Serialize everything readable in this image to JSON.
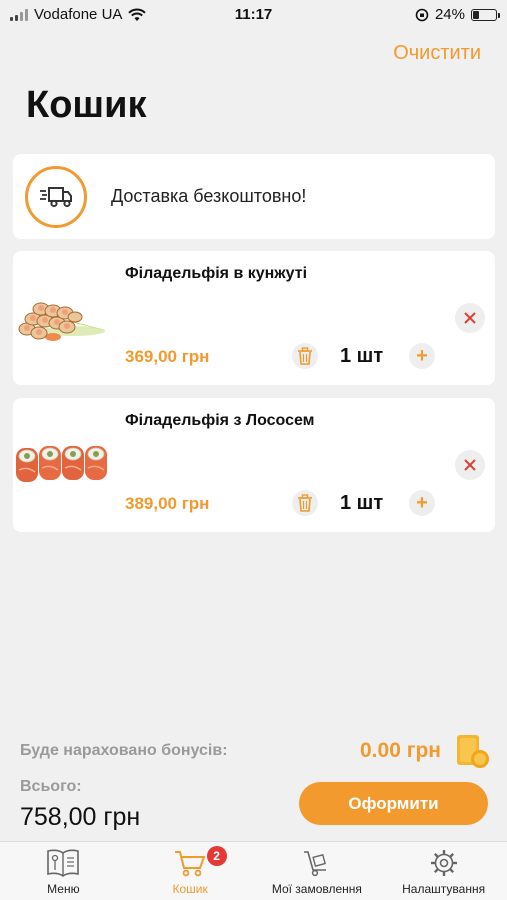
{
  "status_bar": {
    "carrier": "Vodafone UA",
    "time": "11:17",
    "battery": "24%",
    "battery_level": 0.24
  },
  "header": {
    "clear_label": "Очистити",
    "title": "Кошик"
  },
  "delivery": {
    "text": "Доставка безкоштовно!",
    "icon": "truck-icon"
  },
  "items": [
    {
      "name": "Філадельфія в кунжуті",
      "price": "369,00 грн",
      "qty": "1 шт"
    },
    {
      "name": "Філадельфія з Лососем",
      "price": "389,00 грн",
      "qty": "1 шт"
    }
  ],
  "summary": {
    "bonus_label": "Буде нараховано бонусів:",
    "bonus_value": "0.00 грн",
    "total_label": "Всього:",
    "total_value": "758,00 грн",
    "checkout_label": "Оформити"
  },
  "tabbar": {
    "tabs": [
      {
        "label": "Меню",
        "icon": "menu-book-icon"
      },
      {
        "label": "Кошик",
        "icon": "cart-icon",
        "badge": "2",
        "active": true
      },
      {
        "label": "Мої замовлення",
        "icon": "orders-icon"
      },
      {
        "label": "Налаштування",
        "icon": "gear-icon"
      }
    ]
  },
  "colors": {
    "accent": "#f29a2e",
    "remove": "#d9443a",
    "badge": "#e53935",
    "background": "#f0f0f0"
  }
}
